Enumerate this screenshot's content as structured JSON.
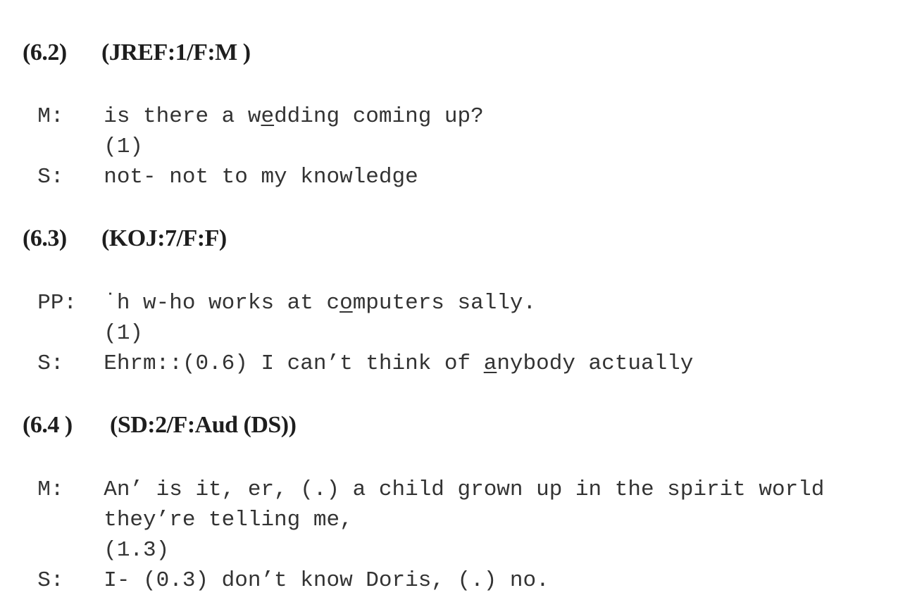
{
  "examples": [
    {
      "number": "(6.2)",
      "code": "(JREF:1/F:M )",
      "lines": [
        {
          "speaker": "M:",
          "pre": "is there a w",
          "underlined": "e",
          "post": "dding coming up?"
        },
        {
          "speaker": "",
          "text": "(1)"
        },
        {
          "speaker": "S:",
          "text": "not- not to my knowledge"
        }
      ]
    },
    {
      "number": "(6.3)",
      "code": "(KOJ:7/F:F)",
      "lines": [
        {
          "speaker": "PP:",
          "pre": "˙h w-ho works at c",
          "underlined": "o",
          "post": "mputers sally."
        },
        {
          "speaker": "",
          "text": "(1)"
        },
        {
          "speaker": "S:",
          "pre": "Ehrm::(0.6) I can’t think of ",
          "underlined": "a",
          "post": "nybody actually"
        }
      ]
    },
    {
      "number": "(6.4 )",
      "code": "(SD:2/F:Aud (DS))",
      "lines": [
        {
          "speaker": "M:",
          "text": "An’ is it, er, (.) a child grown up in the spirit world"
        },
        {
          "speaker": "",
          "text": "they’re telling me,"
        },
        {
          "speaker": "",
          "text": "(1.3)"
        },
        {
          "speaker": "S:",
          "text": "I- (0.3) don’t know Doris, (.) no."
        }
      ]
    }
  ]
}
